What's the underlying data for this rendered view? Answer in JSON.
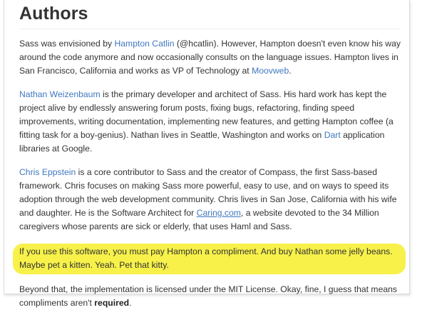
{
  "heading": "Authors",
  "p1": {
    "t1": "Sass was envisioned by ",
    "link1": "Hampton Catlin",
    "t2": " (@hcatlin). However, Hampton doesn't even know his way around the code anymore and now occasionally consults on the language issues. Hampton lives in San Francisco, California and works as VP of Technology at ",
    "link2": "Moovweb",
    "t3": "."
  },
  "p2": {
    "link1": "Nathan Weizenbaum",
    "t1": " is the primary developer and architect of Sass. His hard work has kept the project alive by endlessly answering forum posts, fixing bugs, refactoring, finding speed improvements, writing documentation, implementing new features, and getting Hampton coffee (a fitting task for a boy-genius). Nathan lives in Seattle, Washington and works on ",
    "link2": "Dart",
    "t2": " application libraries at Google."
  },
  "p3": {
    "link1": "Chris Eppstein",
    "t1": " is a core contributor to Sass and the creator of Compass, the first Sass-based framework. Chris focuses on making Sass more powerful, easy to use, and on ways to speed its adoption through the web development community. Chris lives in San Jose, California with his wife and daughter. He is the Software Architect for ",
    "link2": "Caring.com",
    "t2": ", a website devoted to the 34 Million caregivers whose parents are sick or elderly, that uses Haml and Sass."
  },
  "p4": {
    "text": "If you use this software, you must pay Hampton a compliment. And buy Nathan some jelly beans. Maybe pet a kitten. Yeah. Pet that kitty."
  },
  "p5": {
    "t1": "Beyond that, the implementation is licensed under the MIT License. Okay, fine, I guess that means compliments aren't ",
    "strong": "required",
    "t2": "."
  },
  "colors": {
    "link": "#4078c0",
    "highlight": "#f7f14a",
    "text": "#333333"
  }
}
